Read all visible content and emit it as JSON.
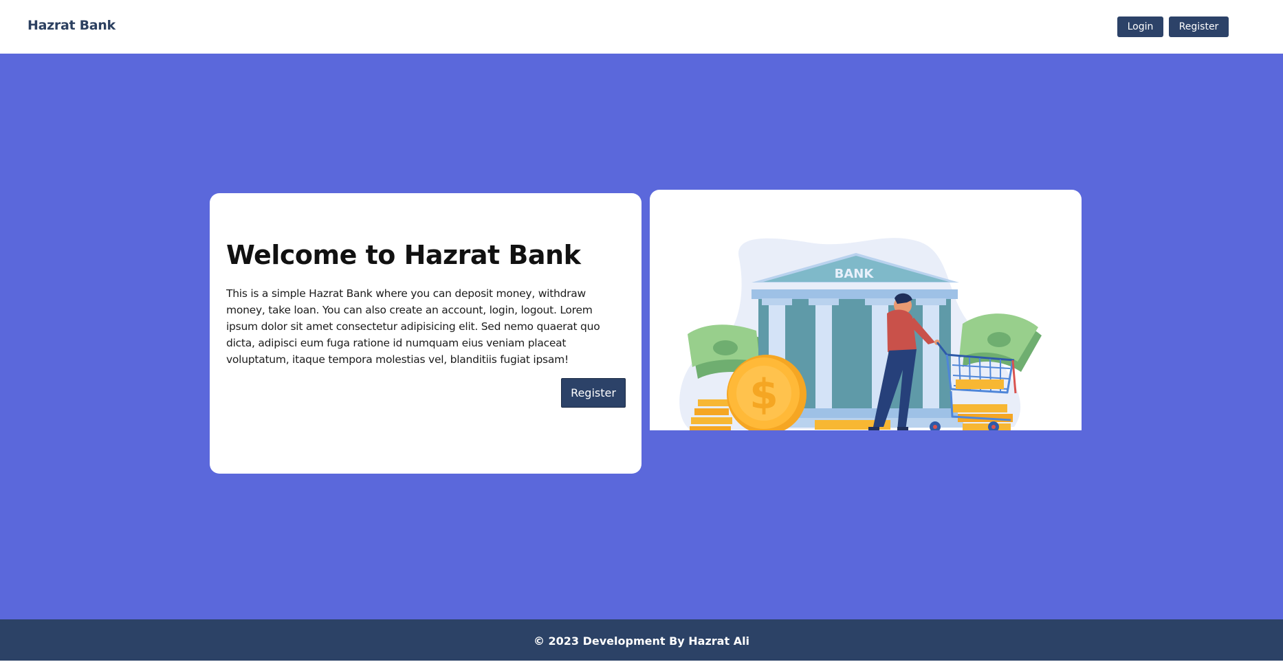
{
  "navbar": {
    "brand": "Hazrat Bank",
    "login_label": "Login",
    "register_label": "Register"
  },
  "hero": {
    "title": "Welcome to Hazrat Bank",
    "description": "This is a simple Hazrat Bank where you can deposit money, withdraw money, take loan. You can also create an account, login, logout. Lorem ipsum dolor sit amet consectetur adipisicing elit. Sed nemo quaerat quo dicta, adipisci eum fuga ratione id numquam eius veniam placeat voluptatum, itaque tempora molestias vel, blanditiis fugiat ipsam!",
    "register_label": "Register",
    "illustration": {
      "sign_text": "BANK",
      "icons": [
        "bank-building-icon",
        "dollar-coin-icon",
        "shopping-cart-icon",
        "money-bills-icon"
      ]
    }
  },
  "footer": {
    "text": "© 2023 Development By Hazrat Ali"
  },
  "colors": {
    "primary_dark": "#2c4268",
    "hero_background": "#5b68db",
    "card_background": "#ffffff",
    "brand_text": "#2c4060"
  }
}
